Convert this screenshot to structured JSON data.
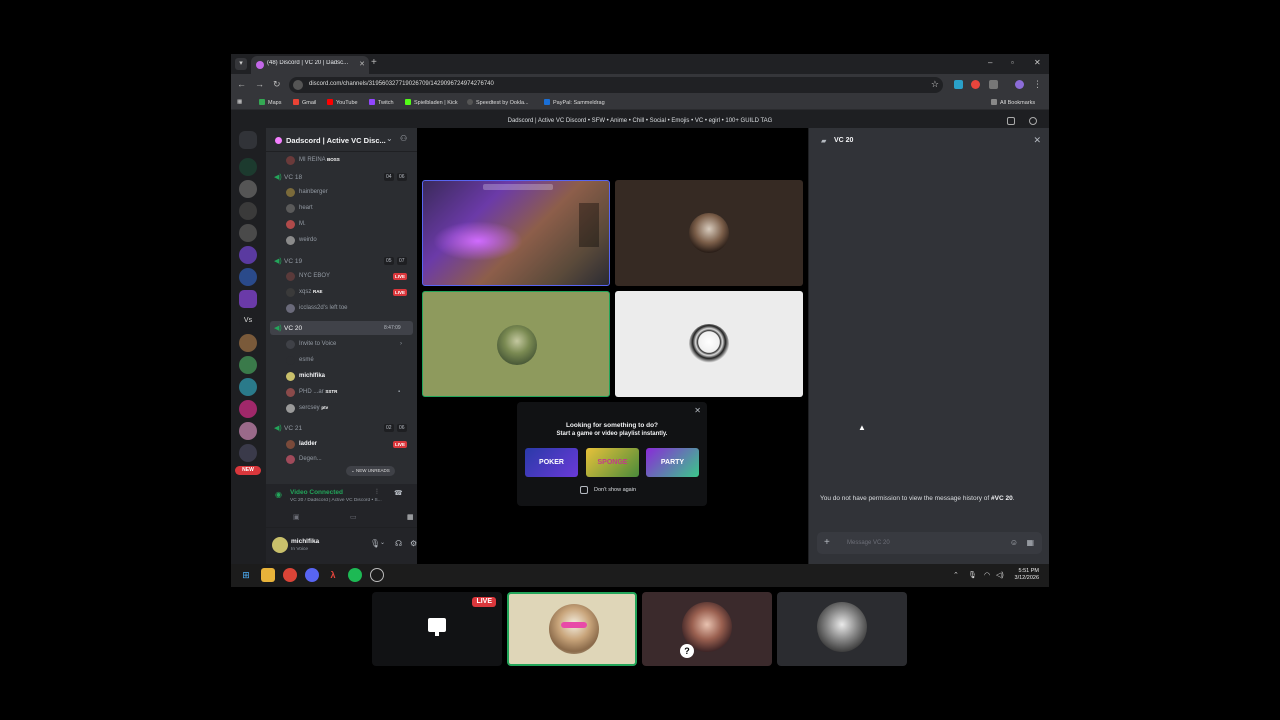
{
  "browser": {
    "tab_title": "(48) Discord | VC 20 | Dadsc...",
    "url": "discord.com/channels/319560327719026709/1429096724974276740",
    "bookmarks": [
      "Maps",
      "Gmail",
      "YouTube",
      "Twitch",
      "Spielbladen | Kick",
      "Speedtest by Ookla...",
      "PayPal: Sammeldrag"
    ],
    "all_bookmarks": "All Bookmarks"
  },
  "discord": {
    "server_title": "Dadscord | Active VC Discord • SFW • Anime • Chill • Social • Emojis • VC • egirl • 100+ GUILD TAG",
    "guild_name": "Dadscord | Active VC Disc...",
    "new_badge": "NEW",
    "rail_letters": "Vs",
    "channels": {
      "top_user": "MI REINA",
      "top_user_tag": "BOSS",
      "vc18": {
        "name": "VC 18",
        "count_a": "04",
        "count_b": "06",
        "users": [
          "hainberger",
          "heart",
          "M.",
          "weirdo"
        ]
      },
      "vc19": {
        "name": "VC 19",
        "count_a": "05",
        "count_b": "07",
        "users": [
          "NYC EBOY",
          "xqsz",
          "icclass2d's left toe"
        ],
        "user2_tag": "RAE",
        "user3_tag": "",
        "live": "LIVE"
      },
      "vc20": {
        "name": "VC 20",
        "time": "8:47:09",
        "invite": "Invite to Voice",
        "users": [
          "esmé",
          "michlfika",
          "PHD ...ar",
          "sercsey"
        ],
        "user3_tag": "SSTR",
        "user4_tag": "ptv"
      },
      "vc21": {
        "name": "VC 21",
        "count_a": "02",
        "count_b": "06",
        "users": [
          "ladder",
          "Degen..."
        ],
        "live": "LIVE"
      }
    },
    "new_unreads": "NEW UNREADS",
    "voice_panel": {
      "status": "Video Connected",
      "sub": "VC 20 / Dadscord | Active VC Discord • S..."
    },
    "user": {
      "name": "michlfika",
      "status": "In Voice"
    },
    "activity": {
      "line1": "Looking for something to do?",
      "line2": "Start a game or video playlist instantly.",
      "cards": [
        "POKER",
        "SPONGE",
        "PARTY"
      ],
      "dont_show": "Don't show again"
    },
    "chat": {
      "title": "VC 20",
      "notice_prefix": "You do not have permission to view the message history of ",
      "notice_channel": "#VC 20",
      "notice_suffix": ".",
      "placeholder": "Message VC 20"
    }
  },
  "taskbar": {
    "time": "5:51 PM",
    "date": "3/12/2026"
  },
  "participants": {
    "live": "LIVE"
  },
  "colors": {
    "accent": "#5865f2",
    "green": "#23a55a",
    "red": "#da373c"
  }
}
